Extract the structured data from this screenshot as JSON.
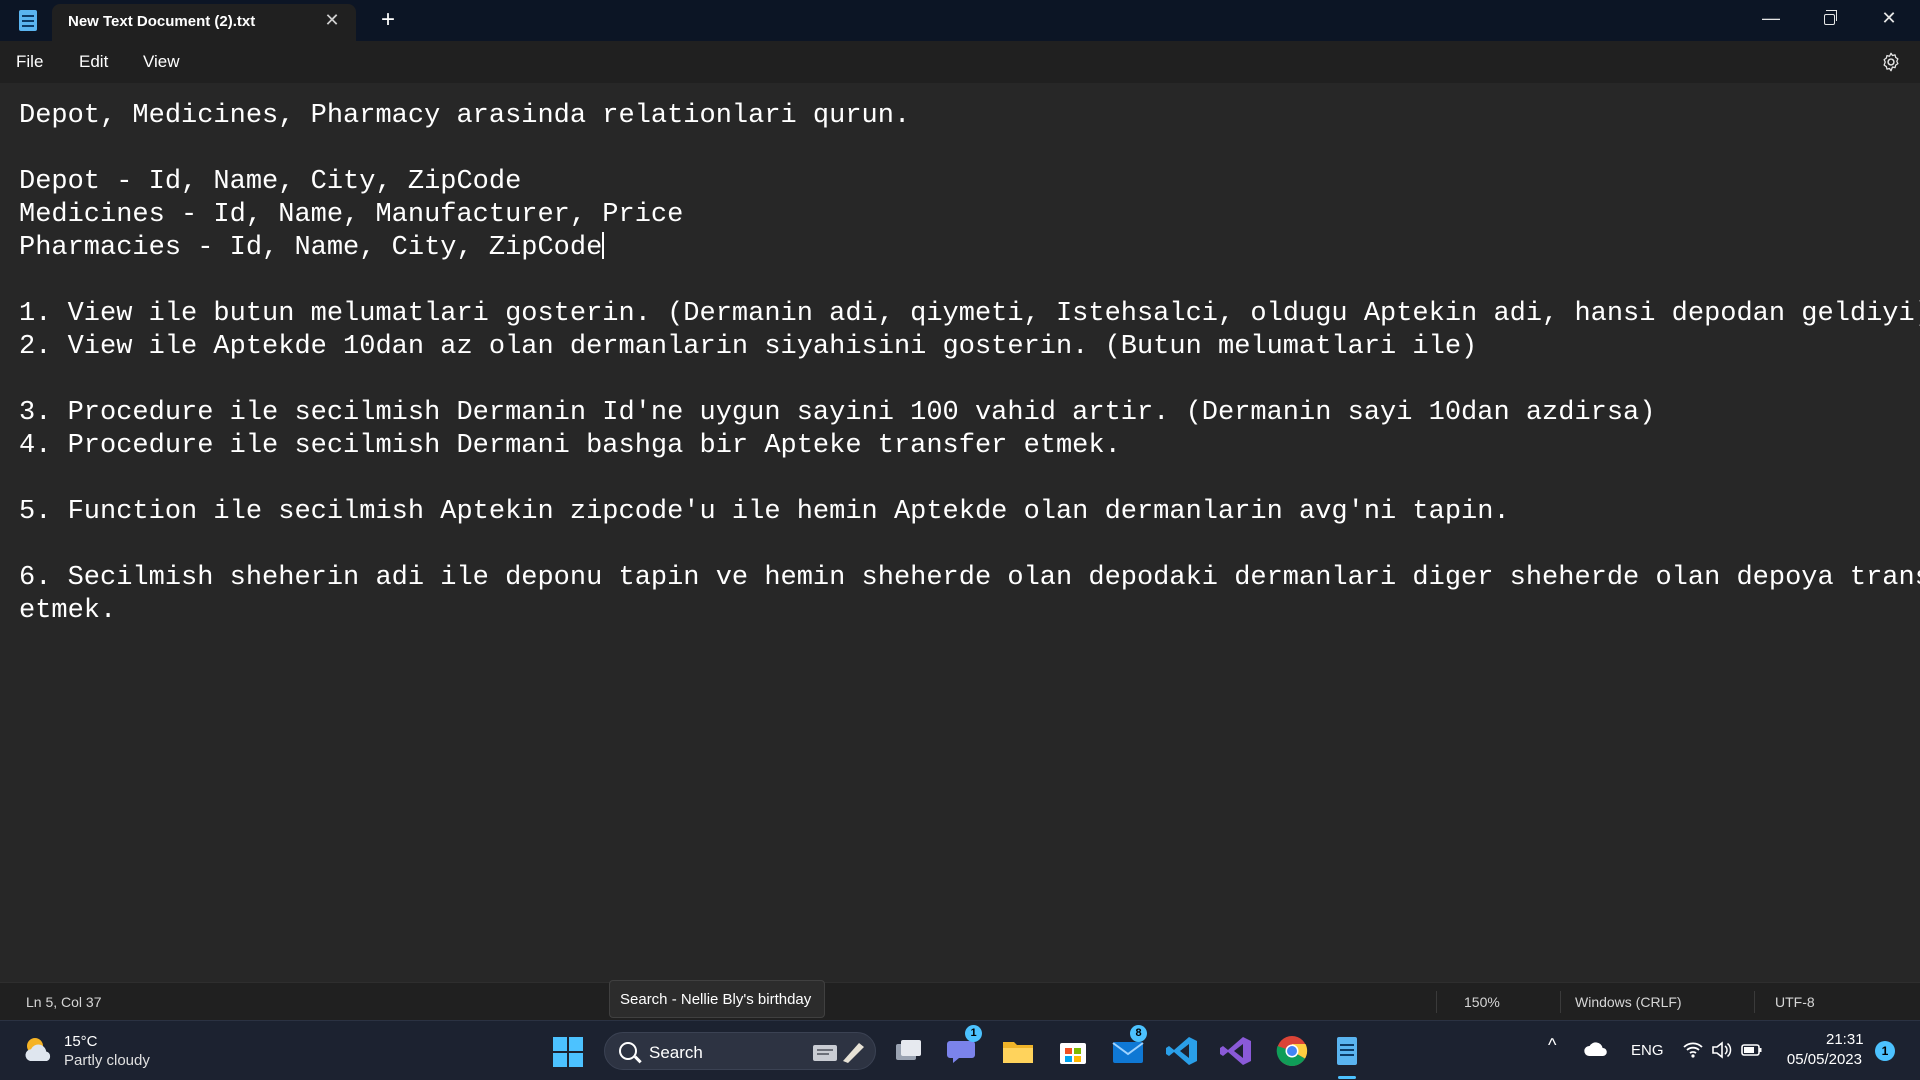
{
  "titlebar": {
    "tab_title": "New Text Document (2).txt",
    "tab_close_glyph": "✕",
    "new_tab_glyph": "+",
    "minimize_glyph": "—",
    "close_glyph": "✕"
  },
  "menu": {
    "items": [
      "File",
      "Edit",
      "View"
    ],
    "settings_icon": "gear-icon"
  },
  "editor": {
    "lines": [
      "Depot, Medicines, Pharmacy arasinda relationlari qurun.",
      "",
      "Depot - Id, Name, City, ZipCode",
      "Medicines - Id, Name, Manufacturer, Price",
      "Pharmacies - Id, Name, City, ZipCode",
      "",
      "1. View ile butun melumatlari gosterin. (Dermanin adi, qiymeti, Istehsalci, oldugu Aptekin adi, hansi depodan geldiyi)",
      "2. View ile Aptekde 10dan az olan dermanlarin siyahisini gosterin. (Butun melumatlari ile)",
      "",
      "3. Procedure ile secilmish Dermanin Id'ne uygun sayini 100 vahid artir. (Dermanin sayi 10dan azdirsa)",
      "4. Procedure ile secilmish Dermani bashga bir Apteke transfer etmek.",
      "",
      "5. Function ile secilmish Aptekin zipcode'u ile hemin Aptekde olan dermanlarin avg'ni tapin.",
      "",
      "6. Secilmish sheherin adi ile deponu tapin ve hemin sheherde olan depodaki dermanlari diger sheherde olan depoya transfer",
      "etmek."
    ],
    "caret_line": 5,
    "caret_col": 37
  },
  "status": {
    "position": "Ln 5, Col 37",
    "zoom": "150%",
    "line_ending": "Windows (CRLF)",
    "encoding": "UTF-8"
  },
  "tooltip": "Search - Nellie Bly's birthday",
  "taskbar": {
    "weather_temp": "15°C",
    "weather_desc": "Partly cloudy",
    "search_label": "Search",
    "teams_badge": "1",
    "mail_badge": "8",
    "language": "ENG",
    "time": "21:31",
    "date": "05/05/2023",
    "notification_count": "1"
  },
  "colors": {
    "accent": "#4cc2ff",
    "editor_bg": "#272727",
    "chrome_bg": "#202020",
    "titlebar_bg": "#0c1525",
    "taskbar_bg": "#1c2230"
  }
}
